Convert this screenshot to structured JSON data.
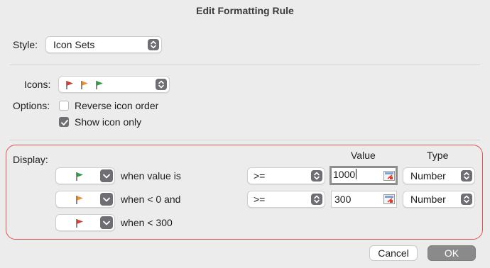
{
  "dialog": {
    "title": "Edit Formatting Rule"
  },
  "style_row": {
    "label": "Style:",
    "value": "Icon Sets"
  },
  "icons_row": {
    "label": "Icons:",
    "flags": [
      {
        "icon": "red-flag-icon",
        "color": "#d93b2f"
      },
      {
        "icon": "orange-flag-icon",
        "color": "#f0922a"
      },
      {
        "icon": "green-flag-icon",
        "color": "#2e9e44"
      }
    ]
  },
  "options": {
    "label": "Options:",
    "reverse_order": {
      "label": "Reverse icon order",
      "checked": false
    },
    "show_icon_only": {
      "label": "Show icon only",
      "checked": true
    }
  },
  "display": {
    "label": "Display:",
    "headers": {
      "value": "Value",
      "type": "Type"
    },
    "rules": [
      {
        "flag_color": "#2e9e44",
        "icon": "green-flag-icon",
        "condition": "when value is",
        "operator": ">=",
        "value": "1000",
        "type": "Number"
      },
      {
        "flag_color": "#f0922a",
        "icon": "orange-flag-icon",
        "condition": "when < 0 and",
        "operator": ">=",
        "value": "300",
        "type": "Number"
      },
      {
        "flag_color": "#d93b2f",
        "icon": "red-flag-icon",
        "condition": "when < 300"
      }
    ]
  },
  "buttons": {
    "cancel": "Cancel",
    "ok": "OK"
  },
  "colors": {
    "highlight_border": "#e05252",
    "background": "#ececec"
  }
}
